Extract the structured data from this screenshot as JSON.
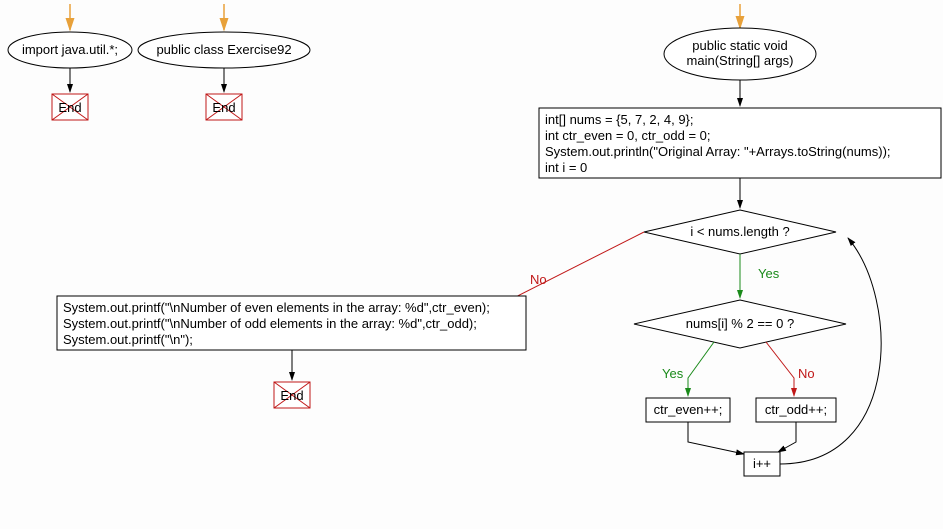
{
  "nodes": {
    "import_text": "import java.util.*;",
    "class_text": "public class Exercise92",
    "main_text_l1": "public static void",
    "main_text_l2": "main(String[] args)",
    "init_l1": "int[] nums = {5, 7, 2, 4, 9};",
    "init_l2": "int ctr_even = 0, ctr_odd = 0;",
    "init_l3": "System.out.println(\"Original Array: \"+Arrays.toString(nums));",
    "init_l4": "int i = 0",
    "cond_loop": "i < nums.length ?",
    "cond_even": "nums[i] % 2 == 0 ?",
    "incr_even": "ctr_even++;",
    "incr_odd": "ctr_odd++;",
    "incr_i": "i++",
    "print_l1": "System.out.printf(\"\\nNumber of even elements in the array: %d\",ctr_even);",
    "print_l2": "System.out.printf(\"\\nNumber of odd elements in the array: %d\",ctr_odd);",
    "print_l3": "System.out.printf(\"\\n\");",
    "end": "End",
    "yes": "Yes",
    "no": "No"
  },
  "chart_data": {
    "type": "flowchart",
    "title": "Java Exercise92: Count even and odd elements in an array",
    "start_nodes": [
      "import java.util.*;",
      "public class Exercise92",
      "public static void main(String[] args)"
    ],
    "process": [
      "int[] nums = {5, 7, 2, 4, 9};",
      "int ctr_even = 0, ctr_odd = 0;",
      "System.out.println(\"Original Array: \"+Arrays.toString(nums));",
      "int i = 0"
    ],
    "loop_condition": "i < nums.length",
    "branch_condition": "nums[i] % 2 == 0",
    "yes_branch": "ctr_even++;",
    "no_branch": "ctr_odd++;",
    "increment": "i++",
    "after_loop": [
      "System.out.printf(\"\\nNumber of even elements in the array: %d\",ctr_even);",
      "System.out.printf(\"\\nNumber of odd elements in the array: %d\",ctr_odd);",
      "System.out.printf(\"\\n\");"
    ],
    "terminals": [
      "End",
      "End",
      "End"
    ]
  }
}
